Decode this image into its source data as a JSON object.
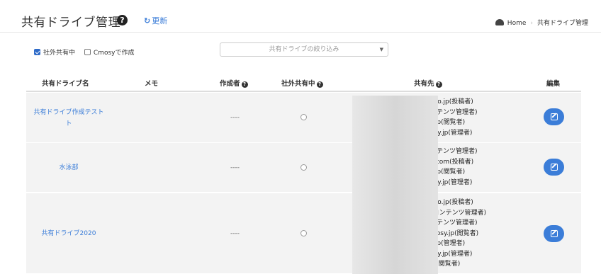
{
  "header": {
    "title": "共有ドライブ管理",
    "help": "?",
    "refresh_icon": "↻",
    "refresh_label": "更新"
  },
  "breadcrumb": {
    "home": "Home",
    "current": "共有ドライブ管理"
  },
  "filters": {
    "external_label": "社外共有中",
    "external_checked": true,
    "cmosy_label": "Cmosyで作成",
    "cmosy_checked": false,
    "select_placeholder": "共有ドライブの絞り込み"
  },
  "table": {
    "headers": {
      "name": "共有ドライブ名",
      "memo": "メモ",
      "creator": "作成者",
      "external": "社外共有中",
      "shares": "共有先",
      "edit": "編集"
    },
    "rows": [
      {
        "name_line1": "共有ドライブ作成テスト",
        "name_line2": "ト",
        "creator": "----",
        "shares": [
          "i.co.jp(投稿者)",
          "ンテンツ管理者)",
          "y.jp(閲覧者)",
          "osy.jp(管理者)"
        ]
      },
      {
        "name_line1": "水泳部",
        "creator": "----",
        "shares": [
          "ンテンツ管理者)",
          "il.com(投稿者)",
          "y.jp(閲覧者)",
          "osy.jp(管理者)"
        ]
      },
      {
        "name_line1": "共有ドライブ2020",
        "creator": "----",
        "shares": [
          "i.co.jp(投稿者)",
          "(コンテンツ管理者)",
          "ンテンツ管理者)",
          "mosy.jp(閲覧者)",
          "y.jp(管理者)",
          "osy.jp(管理者)",
          "jp(閲覧者)"
        ]
      }
    ]
  }
}
